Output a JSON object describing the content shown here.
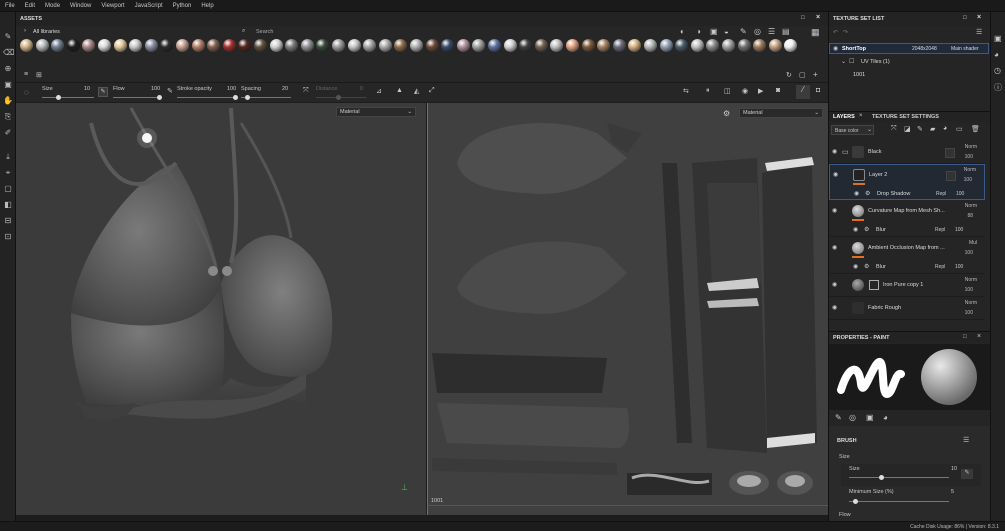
{
  "menubar": {
    "items": [
      "File",
      "Edit",
      "Mode",
      "Window",
      "Viewport",
      "JavaScript",
      "Python",
      "Help"
    ]
  },
  "assets": {
    "title": "ASSETS",
    "library": "All libraries",
    "search_placeholder": "Search",
    "material_colors": [
      "#d2b48c",
      "#b9b9b9",
      "#6f7f8f",
      "#1f1f1f",
      "#a88",
      "#d9d9d9",
      "#e0c89a",
      "#c9c9c9",
      "#8a8fa0",
      "#2b2b2b",
      "#c4a090",
      "#b47e6a",
      "#806050",
      "#a03030",
      "#502820",
      "#605040",
      "#d0d0d0",
      "#7a7a7a",
      "#909090",
      "#3a4a3a",
      "#9b9b9b",
      "#c5c5c5",
      "#a5a5a5",
      "#aaaaaa",
      "#8a6a4a",
      "#b0b0b0",
      "#6a4a3a",
      "#3a4a6a",
      "#b090a0",
      "#a0a0a0",
      "#6070a0",
      "#d0d0d0",
      "#404040",
      "#706050",
      "#bfbfbf",
      "#e0a080",
      "#7a5a3a",
      "#a08060",
      "#6a6a7a",
      "#d4b080",
      "#b8b8b8",
      "#90a0b0",
      "#4a5a6a",
      "#c0c0c0",
      "#8a8a8a",
      "#a0a0a0",
      "#707070",
      "#9a7a5a",
      "#c0a080",
      "#eeeeee"
    ]
  },
  "toolbar": {
    "size_label": "Size",
    "size_value": "10",
    "flow_label": "Flow",
    "flow_value": "100",
    "stroke_opacity_label": "Stroke opacity",
    "stroke_opacity_value": "100",
    "spacing_label": "Spacing",
    "spacing_value": "20",
    "distance_label": "Distance",
    "distance_value": "0"
  },
  "viewport3d": {
    "mode_dropdown": "Material"
  },
  "viewport2d": {
    "mode_dropdown": "Material",
    "uv_tile": "1001"
  },
  "texture_set_list": {
    "title": "TEXTURE SET LIST",
    "set_name": "ShortTop",
    "resolution": "2048x2048",
    "shader": "Main shader",
    "uv_tiles": "UV Tiles (1)",
    "tile": "1001"
  },
  "layers": {
    "tab_layers": "LAYERS",
    "tab_settings": "TEXTURE SET SETTINGS",
    "channel": "Base color",
    "items": [
      {
        "name": "Black",
        "blend": "Norm",
        "opacity": "100"
      },
      {
        "name": "Layer 2",
        "blend": "Norm",
        "opacity": "100"
      },
      {
        "name": "Curvature Map from Mesh Sh...",
        "blend": "Norm",
        "opacity": "88"
      },
      {
        "name": "Ambient Occlusion Map from ...",
        "blend": "Mul",
        "opacity": "100"
      },
      {
        "name": "Iron Pure copy 1",
        "blend": "Norm",
        "opacity": "100"
      },
      {
        "name": "Fabric Rough",
        "blend": "Norm",
        "opacity": "100"
      }
    ],
    "effects": [
      {
        "name": "Drop Shadow",
        "blend": "Repl",
        "opacity": "100"
      },
      {
        "name": "Blur",
        "blend": "Repl",
        "opacity": "100"
      },
      {
        "name": "Blur",
        "blend": "Repl",
        "opacity": "100"
      }
    ]
  },
  "properties": {
    "title": "PROPERTIES - PAINT",
    "brush_title": "BRUSH",
    "size_label": "Size",
    "size_field": "Size",
    "size_value": "10",
    "min_size_label": "Minimum Size (%)",
    "min_size_value": "5",
    "flow_label": "Flow"
  },
  "status": {
    "text": "Cache Disk Usage:  86% | Version: 8.3.1"
  }
}
